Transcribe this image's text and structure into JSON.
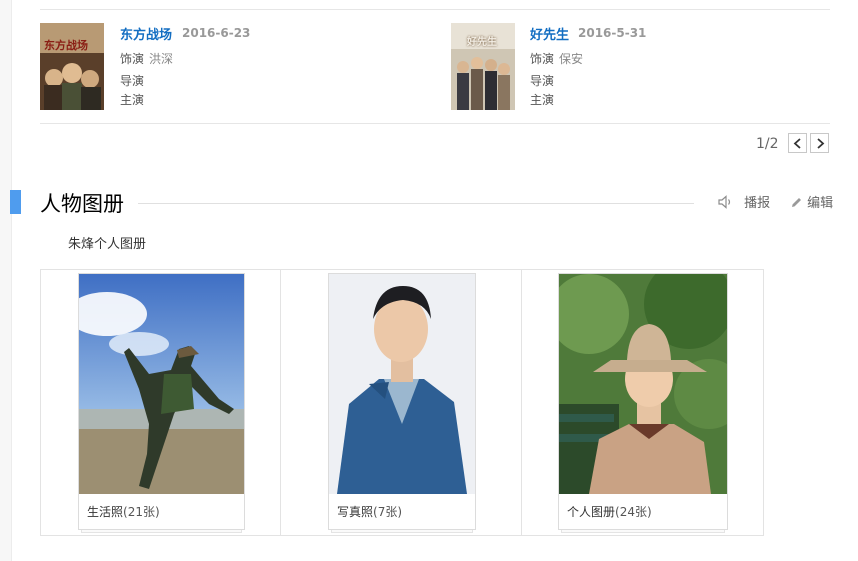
{
  "films": [
    {
      "title": "东方战场",
      "date": "2016-6-23",
      "role_label": "饰演",
      "role": "洪深",
      "director_label": "导演",
      "star_label": "主演",
      "poster_text": "东方战场"
    },
    {
      "title": "好先生",
      "date": "2016-5-31",
      "role_label": "饰演",
      "role": "保安",
      "director_label": "导演",
      "star_label": "主演",
      "poster_text": "好先生"
    }
  ],
  "pager": {
    "text": "1/2"
  },
  "album_section": {
    "title": "人物图册",
    "broadcast_label": "播报",
    "edit_label": "编辑",
    "subtitle": "朱烽个人图册",
    "albums": [
      {
        "name": "生活照",
        "count": "(21张)"
      },
      {
        "name": "写真照",
        "count": "(7张)"
      },
      {
        "name": "个人图册",
        "count": "(24张)"
      }
    ]
  },
  "colors": {
    "link_blue": "#136ec2",
    "section_marker": "#4f9cee"
  }
}
